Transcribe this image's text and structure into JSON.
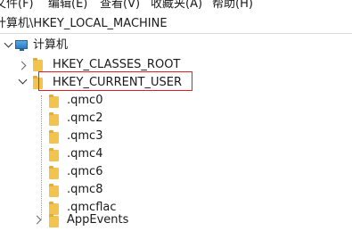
{
  "menu": {
    "items": [
      {
        "label": "文件(F)"
      },
      {
        "label": "编辑(E)"
      },
      {
        "label": "查看(V)"
      },
      {
        "label": "收藏夹(A)"
      },
      {
        "label": "帮助(H)"
      }
    ]
  },
  "address": {
    "path": "计算机\\HKEY_LOCAL_MACHINE"
  },
  "tree": {
    "root_label": "计算机",
    "classes_root": "HKEY_CLASSES_ROOT",
    "current_user": "HKEY_CURRENT_USER",
    "children": [
      {
        "label": ".qmc0"
      },
      {
        "label": ".qmc2"
      },
      {
        "label": ".qmc3"
      },
      {
        "label": ".qmc4"
      },
      {
        "label": ".qmc6"
      },
      {
        "label": ".qmc8"
      },
      {
        "label": ".qmcflac"
      },
      {
        "label": "AppEvents"
      }
    ]
  },
  "colors": {
    "highlight_border": "#e02020",
    "folder": "#f2c34e"
  }
}
